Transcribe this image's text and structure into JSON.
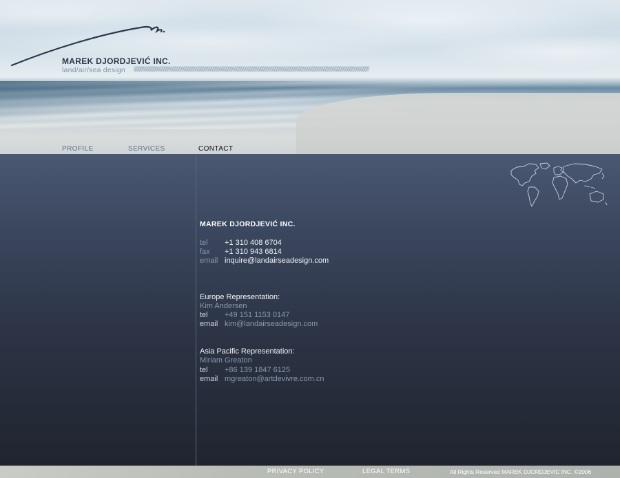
{
  "header": {
    "company_name": "MAREK DJORDJEVIĆ INC.",
    "tagline": "land/air/sea design",
    "slash_pattern": "////////////////////////////////////////////////////////////////////////////////////////////////////////////////////////////////////////////////////////////////////////////////////////////////////////////////////////"
  },
  "nav": {
    "items": [
      {
        "label": "PROFILE",
        "active": false
      },
      {
        "label": "SERVICES",
        "active": false
      },
      {
        "label": "CONTACT",
        "active": true
      }
    ]
  },
  "contact": {
    "company_name": "MAREK DJORDJEVIĆ INC.",
    "main": {
      "tel_label": "tel",
      "tel": "+1 310 408 6704",
      "fax_label": "fax",
      "fax": "+1 310 943 6814",
      "email_label": "email",
      "email": "inquire@landairseadesign.com"
    },
    "europe": {
      "title": "Europe Representation:",
      "name": "Kim Andersen",
      "tel_label": "tel",
      "tel": "+49 151 1153 0147",
      "email_label": "email",
      "email": "kim@landairseadesign.com"
    },
    "asia": {
      "title": "Asia Pacific Representation:",
      "name": "Miriam Greaton",
      "tel_label": "tel",
      "tel": "+86 139 1847 6125",
      "email_label": "email",
      "email": "mgreaton@artdevivre.com.cn"
    }
  },
  "footer": {
    "privacy": "PRIVACY POLICY",
    "legal": "LEGAL TERMS",
    "copyright": "All Rights Reserved MAREK DJORDJEVIC INC. ©2006"
  },
  "colors": {
    "main_top": "#4a5872",
    "main_bottom": "#20242f",
    "label_grey": "#8a98ad",
    "nav_active": "#0c0f16"
  },
  "icons": {
    "logo": "signature-swoosh-icon",
    "map": "world-map-icon"
  }
}
